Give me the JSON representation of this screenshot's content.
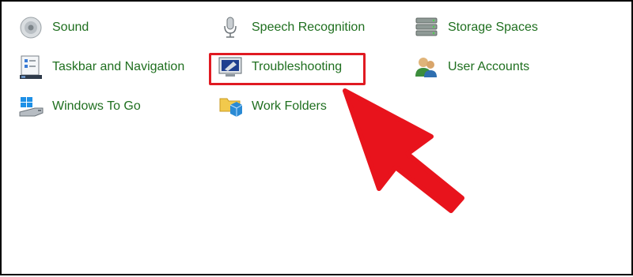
{
  "control_panel": {
    "items": [
      {
        "label": "Sound",
        "icon": "speaker-icon"
      },
      {
        "label": "Speech Recognition",
        "icon": "microphone-icon"
      },
      {
        "label": "Storage Spaces",
        "icon": "storage-drives-icon"
      },
      {
        "label": "Taskbar and Navigation",
        "icon": "taskbar-icon"
      },
      {
        "label": "Troubleshooting",
        "icon": "troubleshooting-icon"
      },
      {
        "label": "User Accounts",
        "icon": "users-icon"
      },
      {
        "label": "Windows To Go",
        "icon": "windows-usb-icon"
      },
      {
        "label": "Work Folders",
        "icon": "work-folders-icon"
      }
    ]
  },
  "annotation": {
    "highlight_color": "#e01a22",
    "arrow_color": "#e8131c"
  },
  "colors": {
    "link_text": "#1f6f1f",
    "background": "#ffffff",
    "border": "#000000"
  }
}
